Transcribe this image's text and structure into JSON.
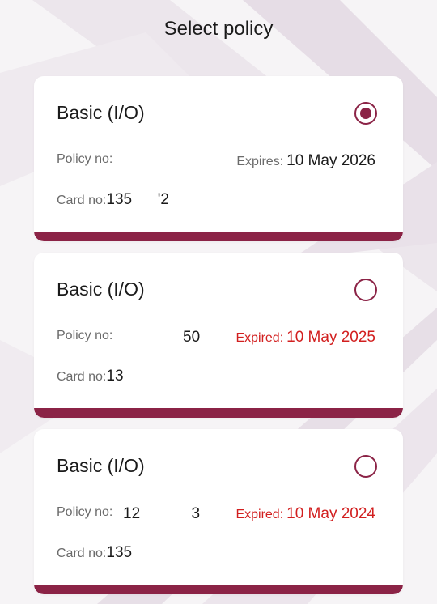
{
  "header": {
    "title": "Select policy"
  },
  "colors": {
    "accent": "#8b2346",
    "expired": "#d21f1f"
  },
  "policies": [
    {
      "name": "Basic (I/O)",
      "selected": true,
      "policy_label": "Policy no:",
      "policy_no": "",
      "expiry_label": "Expires:",
      "expiry_date": "10 May 2026",
      "card_label": "Card no:",
      "card_no": "135      '2"
    },
    {
      "name": "Basic (I/O)",
      "selected": false,
      "policy_label": "Policy no:",
      "policy_no": "50",
      "expiry_label": "Expired:",
      "expiry_date": "10 May 2025",
      "card_label": "Card no:",
      "card_no": "13"
    },
    {
      "name": "Basic (I/O)",
      "selected": false,
      "policy_label": "Policy no:",
      "policy_no": "12            3",
      "expiry_label": "Expired:",
      "expiry_date": "10 May 2024",
      "card_label": "Card no:",
      "card_no": "135"
    }
  ]
}
